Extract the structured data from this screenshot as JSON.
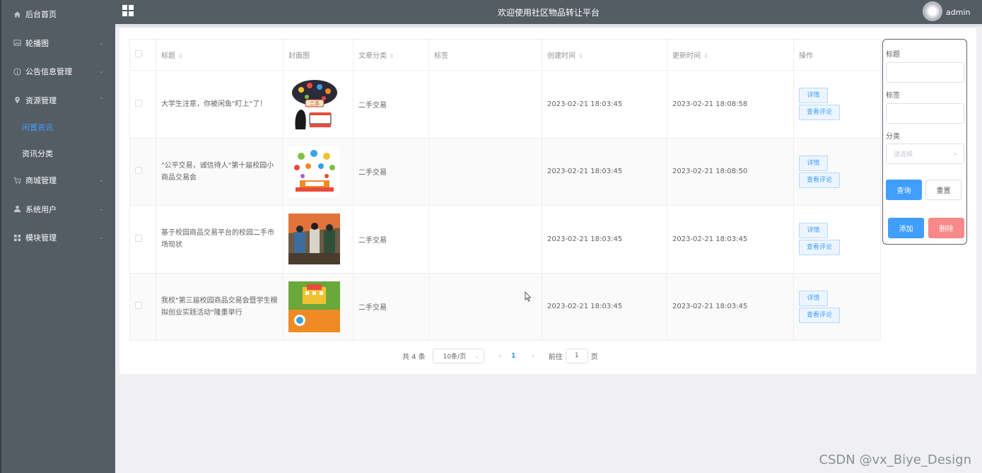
{
  "sidebar": {
    "items": [
      {
        "label": "后台首页",
        "icon": "home-icon",
        "has_chevron": false
      },
      {
        "label": "轮播图",
        "icon": "image-icon",
        "has_chevron": true
      },
      {
        "label": "公告信息管理",
        "icon": "info-icon",
        "has_chevron": true
      },
      {
        "label": "资源管理",
        "icon": "location-icon",
        "has_chevron": true,
        "expanded": true,
        "children": [
          {
            "label": "闲置资讯",
            "active": true
          },
          {
            "label": "资讯分类",
            "active": false
          }
        ]
      },
      {
        "label": "商城管理",
        "icon": "cart-icon",
        "has_chevron": true
      },
      {
        "label": "系统用户",
        "icon": "user-icon",
        "has_chevron": true
      },
      {
        "label": "模块管理",
        "icon": "grid-icon",
        "has_chevron": true
      }
    ],
    "bg_color": "#545c64",
    "active_color": "#409eff"
  },
  "header": {
    "title": "欢迎使用社区物品转让平台",
    "username": "admin",
    "menu_icon": "grid-menu-icon"
  },
  "table": {
    "columns": [
      "标题",
      "封面图",
      "文章分类",
      "标签",
      "创建时间",
      "更新时间",
      "操作"
    ],
    "sortable": [
      true,
      false,
      true,
      false,
      true,
      true,
      false
    ],
    "rows": [
      {
        "title": "大学生注意，你被闲鱼\"盯上\"了！",
        "cover": "cover-secondhand-cloud",
        "category": "二手交易",
        "tag": "",
        "created": "2023-02-21 18:03:45",
        "updated": "2023-02-21 18:08:58"
      },
      {
        "title": "\"公平交易，诚信待人\"第十届校园小商品交易会",
        "cover": "cover-trade-fair",
        "category": "二手交易",
        "tag": "",
        "created": "2023-02-21 18:03:45",
        "updated": "2023-02-21 18:08:50"
      },
      {
        "title": "基于校园商品交易平台的校园二手市场现状",
        "cover": "cover-campus-market",
        "category": "二手交易",
        "tag": "",
        "created": "2023-02-21 18:03:45",
        "updated": "2023-02-21 18:03:45"
      },
      {
        "title": "我校\"第三届校园商品交易会暨学生模拟创业实践活动\"隆重举行",
        "cover": "cover-secondhand-banner",
        "category": "二手交易",
        "tag": "",
        "created": "2023-02-21 18:03:45",
        "updated": "2023-02-21 18:03:45"
      }
    ],
    "action_detail": "详情",
    "action_comments": "查看评论"
  },
  "pagination": {
    "total_text": "共 4 条",
    "page_size": "10条/页",
    "current_page": "1",
    "goto_prefix": "前往",
    "goto_value": "1",
    "goto_suffix": "页"
  },
  "search_panel": {
    "title_label": "标题",
    "tag_label": "标签",
    "category_label": "分类",
    "category_placeholder": "请选择",
    "query_button": "查询",
    "reset_button": "重置",
    "add_button": "添加",
    "delete_button": "删除"
  },
  "watermark": "CSDN @vx_Biye_Design",
  "colors": {
    "primary": "#409eff",
    "danger": "#f78989",
    "header_bg": "#545c64"
  }
}
